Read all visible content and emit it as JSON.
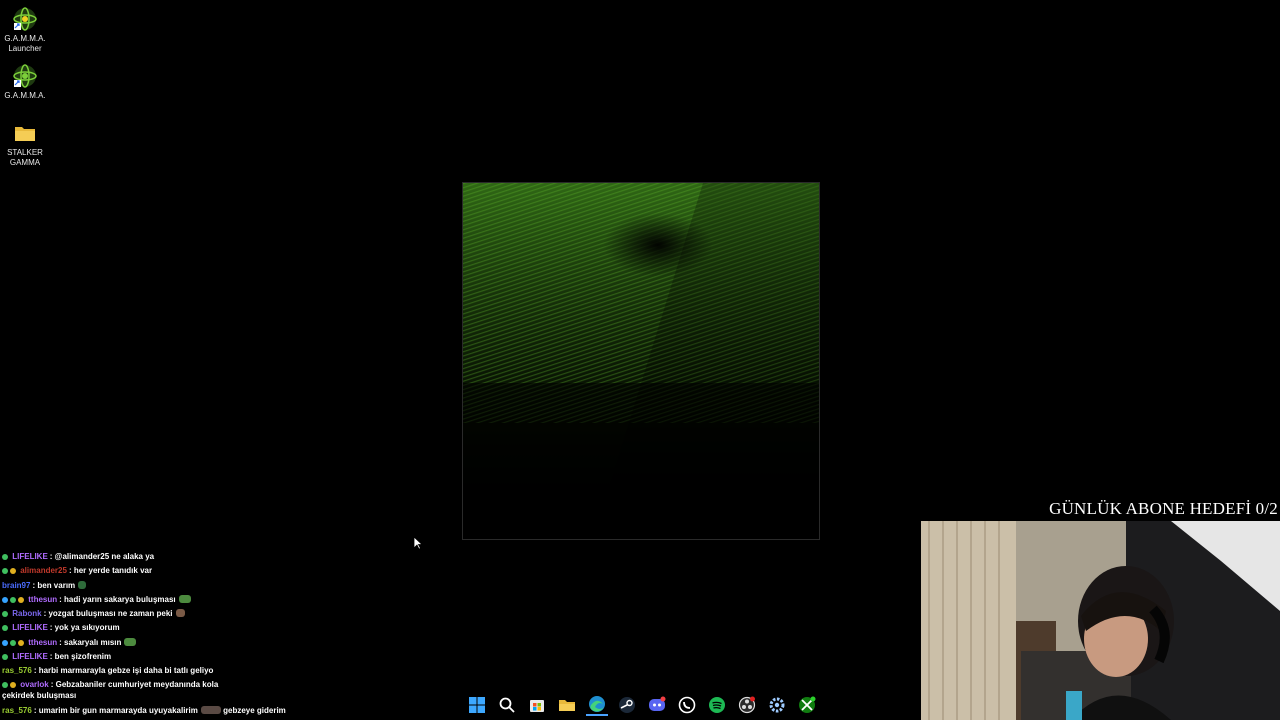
{
  "desktop": {
    "icons": [
      {
        "label_line1": "G.A.M.M.A.",
        "label_line2": "Launcher",
        "icon": "gamma-launcher-icon"
      },
      {
        "label_line1": "G.A.M.M.A.",
        "label_line2": "",
        "icon": "gamma-icon"
      },
      {
        "label_line1": "STALKER",
        "label_line2": "GAMMA",
        "icon": "folder-icon"
      }
    ]
  },
  "overlay": {
    "goal_text": "GÜNLÜK ABONE HEDEFİ 0/2"
  },
  "chat": {
    "messages": [
      {
        "user": "LIFELIKE",
        "text": ": @alimander25 ne alaka ya",
        "color": "#b06cff",
        "badges": [
          "#3fbf5f"
        ]
      },
      {
        "user": "alimander25",
        "text": ": her yerde tanıdık var",
        "color": "#c0392b",
        "badges": [
          "#3fbf5f",
          "#e0b020"
        ]
      },
      {
        "user": "brain97",
        "text": ": ben varım",
        "color": "#4a6cff",
        "badges": []
      },
      {
        "user": "tthesun",
        "text": ": hadi yarın sakarya buluşması",
        "color": "#b06cff",
        "badges": [
          "#36a3ff",
          "#3fbf5f",
          "#e0b020"
        ]
      },
      {
        "user": "Rabonk",
        "text": ": yozgat buluşması ne zaman peki",
        "color": "#7b68ee",
        "badges": [
          "#3fbf5f"
        ]
      },
      {
        "user": "LIFELIKE",
        "text": ": yok ya sıkıyorum",
        "color": "#b06cff",
        "badges": [
          "#3fbf5f"
        ]
      },
      {
        "user": "tthesun",
        "text": ": sakaryalı mısın",
        "color": "#b06cff",
        "badges": [
          "#36a3ff",
          "#3fbf5f",
          "#e0b020"
        ]
      },
      {
        "user": "LIFELIKE",
        "text": ": ben şizofrenim",
        "color": "#b06cff",
        "badges": [
          "#3fbf5f"
        ]
      },
      {
        "user": "ras_576",
        "text": ": harbi marmarayla gebze işi daha bi tatlı geliyo",
        "color": "#9acd32",
        "badges": []
      },
      {
        "user": "ovarlok",
        "text": ": Gebzabaniler cumhuriyet meydanında kola çekirdek buluşması",
        "color": "#b06cff",
        "badges": [
          "#3fbf5f",
          "#e0b020"
        ]
      },
      {
        "user": "ras_576",
        "text": ": umarim bir gun marmarayda uyuyakalirim",
        "text2": "gebzeye giderim",
        "color": "#9acd32",
        "badges": []
      }
    ]
  },
  "taskbar": {
    "items": [
      {
        "name": "start-icon"
      },
      {
        "name": "search-icon"
      },
      {
        "name": "store-icon"
      },
      {
        "name": "file-explorer-icon"
      },
      {
        "name": "edge-browser-icon"
      },
      {
        "name": "steam-icon"
      },
      {
        "name": "discord-icon"
      },
      {
        "name": "whatsapp-icon"
      },
      {
        "name": "spotify-icon"
      },
      {
        "name": "obs-icon"
      },
      {
        "name": "settings-icon"
      },
      {
        "name": "xbox-icon"
      }
    ]
  },
  "colors": {
    "splash_green": "#3a7a1a",
    "desktop_bg": "#000000"
  }
}
